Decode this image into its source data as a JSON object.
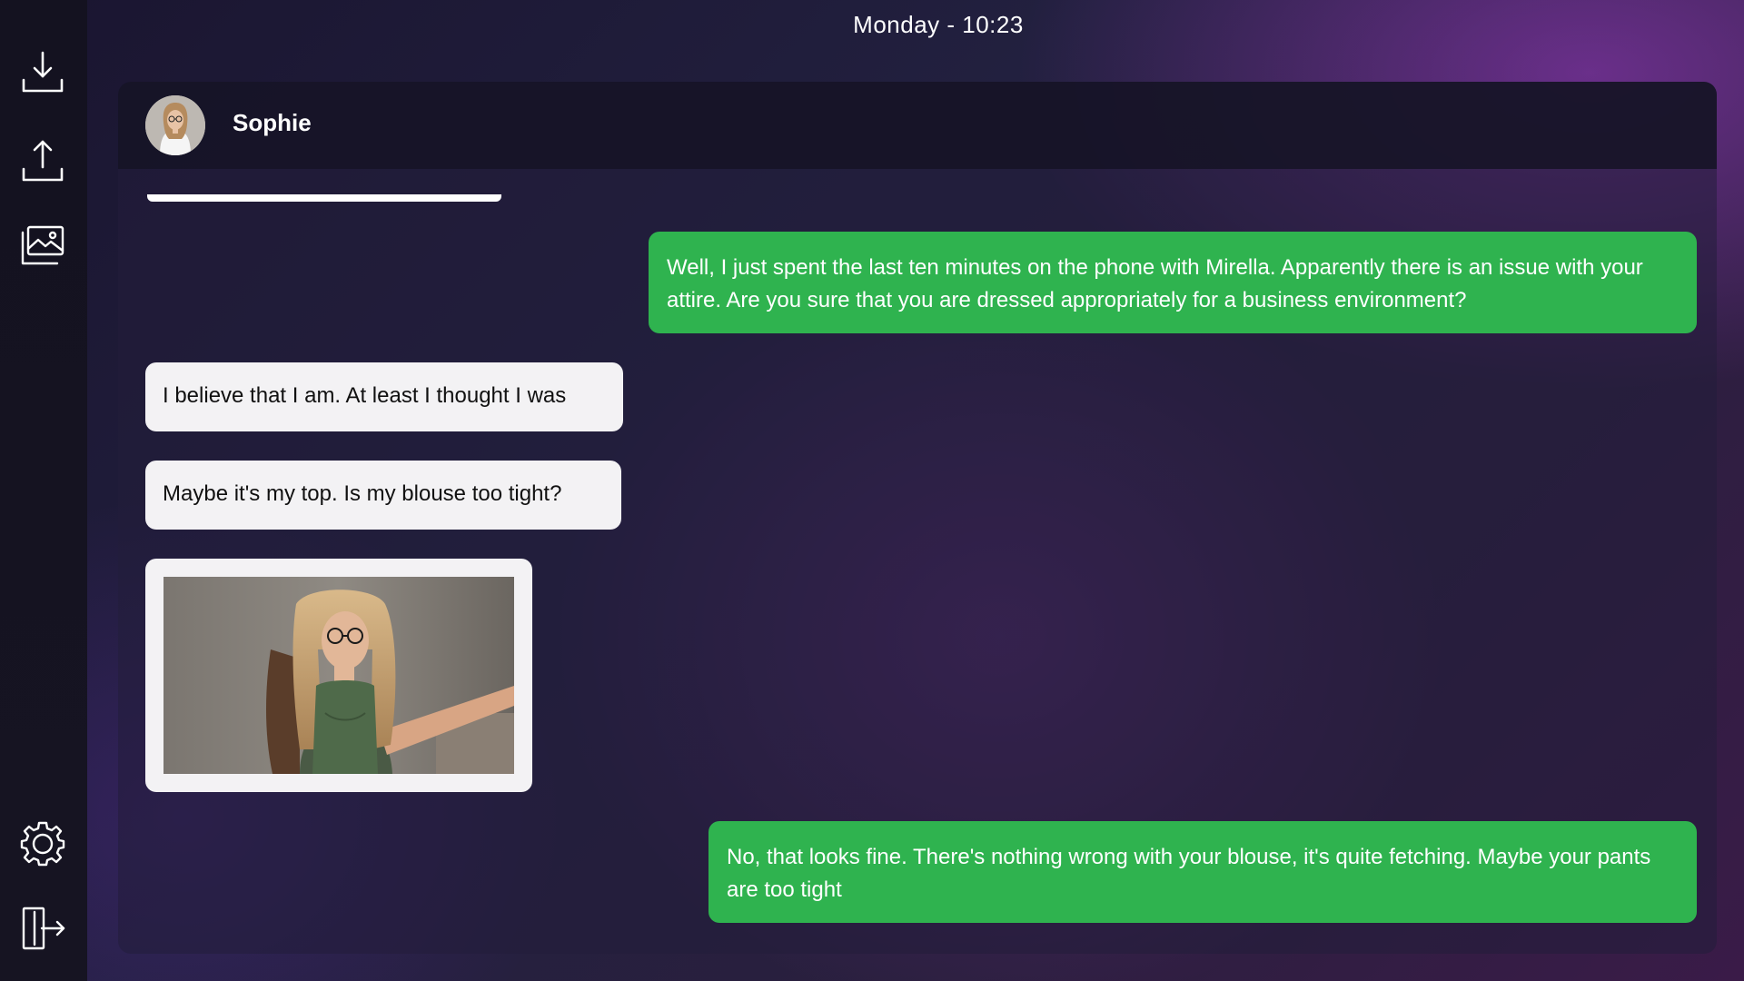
{
  "header": {
    "clock": "Monday - 10:23"
  },
  "sidebar": {
    "items": [
      {
        "name": "download",
        "icon": "download-icon"
      },
      {
        "name": "upload",
        "icon": "upload-icon"
      },
      {
        "name": "gallery",
        "icon": "gallery-icon"
      },
      {
        "name": "settings",
        "icon": "gear-icon"
      },
      {
        "name": "exit",
        "icon": "exit-icon"
      }
    ]
  },
  "chat": {
    "contact_name": "Sophie",
    "messages": [
      {
        "direction": "outgoing",
        "text": "Well, I just spent the last ten minutes on the phone with Mirella. Apparently there is an issue with your attire. Are you sure that you are dressed appropriately for a business environment?"
      },
      {
        "direction": "incoming",
        "text": "I believe that I am. At least I thought I was"
      },
      {
        "direction": "incoming",
        "text": "Maybe it's my top. Is my blouse too tight?"
      },
      {
        "direction": "incoming",
        "type": "image"
      },
      {
        "direction": "outgoing",
        "text": "No, that looks fine. There's nothing wrong with your blouse, it's quite fetching. Maybe your pants are too tight"
      }
    ]
  },
  "colors": {
    "outgoing_bubble": "#2fb34f",
    "incoming_bubble": "#f3f2f4",
    "sidebar_bg": "#141220",
    "header_bg": "#161326"
  }
}
